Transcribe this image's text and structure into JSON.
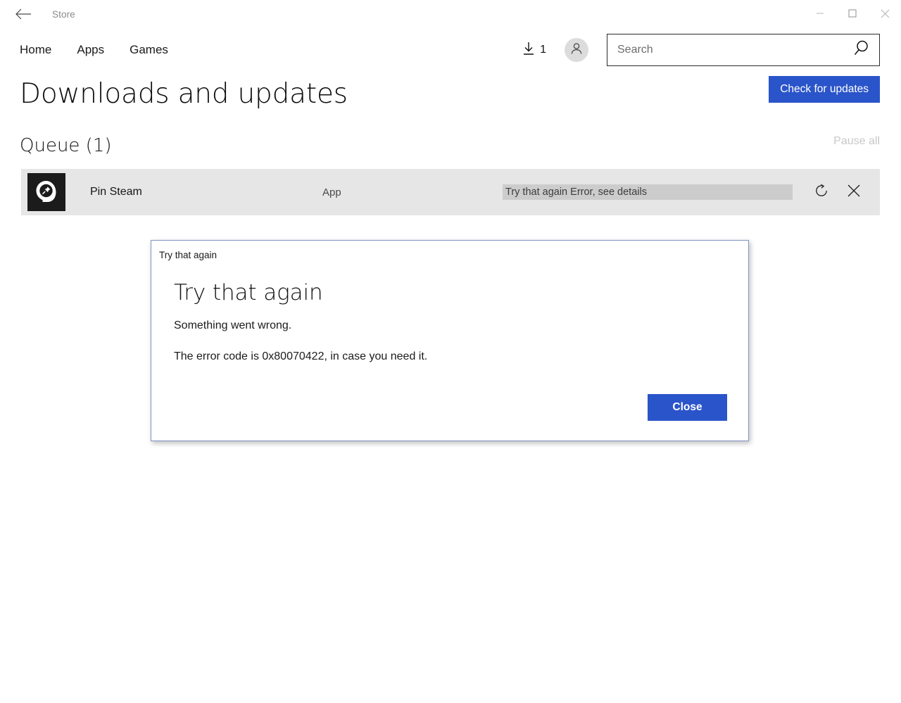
{
  "window": {
    "app_title": "Store",
    "back_icon": "back-arrow-icon",
    "minimize_icon": "minimize-icon",
    "maximize_icon": "maximize-icon",
    "close_icon": "close-icon"
  },
  "nav": {
    "links": [
      {
        "label": "Home"
      },
      {
        "label": "Apps"
      },
      {
        "label": "Games"
      }
    ],
    "downloads": {
      "icon": "download-arrow-icon",
      "count": "1"
    },
    "account": {
      "icon": "user-avatar-icon"
    },
    "search": {
      "placeholder": "Search",
      "value": "",
      "icon": "search-icon"
    }
  },
  "page": {
    "title": "Downloads and updates",
    "check_updates_label": "Check for updates"
  },
  "queue": {
    "title": "Queue (1)",
    "pause_all_label": "Pause all",
    "items": [
      {
        "icon": "pin-steam-app-icon",
        "name": "Pin Steam",
        "kind": "App",
        "status": "Try that again Error, see details",
        "retry_icon": "retry-icon",
        "cancel_icon": "close-icon"
      }
    ]
  },
  "dialog": {
    "titlebar": "Try that again",
    "heading": "Try that again",
    "line1": "Something went wrong.",
    "line2": "The error code is 0x80070422, in case you need it.",
    "close_label": "Close"
  },
  "colors": {
    "accent_blue": "#2a54c9",
    "row_background": "#e6e6e6",
    "progress_track": "#cccccc",
    "dialog_border": "#8294c4",
    "disabled_text": "#c8c8c8"
  }
}
